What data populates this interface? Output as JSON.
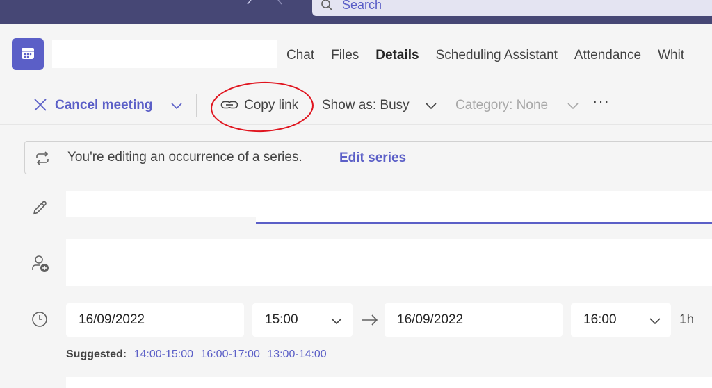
{
  "search": {
    "placeholder": "Search"
  },
  "tabs": [
    {
      "label": "Chat"
    },
    {
      "label": "Files"
    },
    {
      "label": "Details"
    },
    {
      "label": "Scheduling Assistant"
    },
    {
      "label": "Attendance"
    },
    {
      "label": "Whit"
    }
  ],
  "active_tab": "Details",
  "toolbar": {
    "cancel_label": "Cancel meeting",
    "copy_link_label": "Copy link",
    "show_as_label": "Show as: Busy",
    "category_label": "Category: None",
    "more_label": "···"
  },
  "banner": {
    "text": "You're editing an occurrence of a series.",
    "link": "Edit series"
  },
  "schedule": {
    "start_date": "16/09/2022",
    "start_time": "15:00",
    "end_date": "16/09/2022",
    "end_time": "16:00",
    "duration": "1h",
    "suggested_label": "Suggested:",
    "suggested_slots": [
      "14:00-15:00",
      "16:00-17:00",
      "13:00-14:00"
    ]
  },
  "colors": {
    "brand": "#5b5fc7",
    "topbar": "#464775",
    "annotation": "#e0141e"
  }
}
